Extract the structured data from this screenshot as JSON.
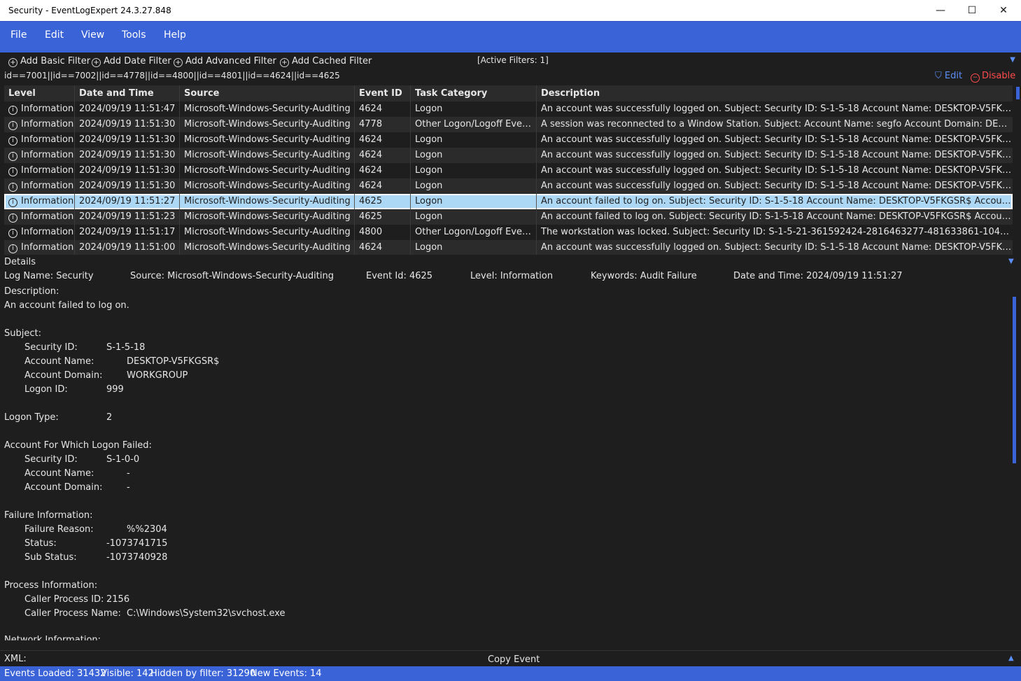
{
  "window": {
    "title": "Security - EventLogExpert 24.3.27.848",
    "minimize": "—",
    "maximize": "☐",
    "close": "✕"
  },
  "menu": [
    "File",
    "Edit",
    "View",
    "Tools",
    "Help"
  ],
  "filter_bar": {
    "add_basic": "Add Basic Filter",
    "add_date": "Add Date Filter",
    "add_advanced": "Add Advanced Filter",
    "add_cached": "Add Cached Filter",
    "active_filters": "[Active Filters: 1]",
    "expression": "id==7001||id==7002||id==4778||id==4800||id==4801||id==4624||id==4625",
    "edit_label": "Edit",
    "disable_label": "Disable"
  },
  "table": {
    "columns": [
      "Level",
      "Date and Time",
      "Source",
      "Event ID",
      "Task Category",
      "Description"
    ],
    "rows": [
      {
        "level": "Information",
        "date": "2024/09/19 11:51:47",
        "source": "Microsoft-Windows-Security-Auditing",
        "event_id": "4624",
        "task": "Logon",
        "desc": "An account was successfully logged on. Subject: Security ID: S-1-5-18 Account Name: DESKTOP-V5FKGSR$ Acco..."
      },
      {
        "level": "Information",
        "date": "2024/09/19 11:51:30",
        "source": "Microsoft-Windows-Security-Auditing",
        "event_id": "4778",
        "task": "Other Logon/Logoff Events",
        "desc": "A session was reconnected to a Window Station. Subject: Account Name: segfo Account Domain: DESKTOP-V5FK..."
      },
      {
        "level": "Information",
        "date": "2024/09/19 11:51:30",
        "source": "Microsoft-Windows-Security-Auditing",
        "event_id": "4624",
        "task": "Logon",
        "desc": "An account was successfully logged on. Subject: Security ID: S-1-5-18 Account Name: DESKTOP-V5FKGSR$ Acco..."
      },
      {
        "level": "Information",
        "date": "2024/09/19 11:51:30",
        "source": "Microsoft-Windows-Security-Auditing",
        "event_id": "4624",
        "task": "Logon",
        "desc": "An account was successfully logged on. Subject: Security ID: S-1-5-18 Account Name: DESKTOP-V5FKGSR$ Acco..."
      },
      {
        "level": "Information",
        "date": "2024/09/19 11:51:30",
        "source": "Microsoft-Windows-Security-Auditing",
        "event_id": "4624",
        "task": "Logon",
        "desc": "An account was successfully logged on. Subject: Security ID: S-1-5-18 Account Name: DESKTOP-V5FKGSR$ Acco..."
      },
      {
        "level": "Information",
        "date": "2024/09/19 11:51:30",
        "source": "Microsoft-Windows-Security-Auditing",
        "event_id": "4624",
        "task": "Logon",
        "desc": "An account was successfully logged on. Subject: Security ID: S-1-5-18 Account Name: DESKTOP-V5FKGSR$ Acco..."
      },
      {
        "level": "Information",
        "date": "2024/09/19 11:51:27",
        "source": "Microsoft-Windows-Security-Auditing",
        "event_id": "4625",
        "task": "Logon",
        "desc": "An account failed to log on. Subject: Security ID: S-1-5-18 Account Name: DESKTOP-V5FKGSR$ Account Domain:..."
      },
      {
        "level": "Information",
        "date": "2024/09/19 11:51:23",
        "source": "Microsoft-Windows-Security-Auditing",
        "event_id": "4625",
        "task": "Logon",
        "desc": "An account failed to log on. Subject: Security ID: S-1-5-18 Account Name: DESKTOP-V5FKGSR$ Account Domain:..."
      },
      {
        "level": "Information",
        "date": "2024/09/19 11:51:17",
        "source": "Microsoft-Windows-Security-Auditing",
        "event_id": "4800",
        "task": "Other Logon/Logoff Events",
        "desc": "The workstation was locked. Subject: Security ID: S-1-5-21-361592424-2816463277-481633861-1043 Account N..."
      },
      {
        "level": "Information",
        "date": "2024/09/19 11:51:00",
        "source": "Microsoft-Windows-Security-Auditing",
        "event_id": "4624",
        "task": "Logon",
        "desc": "An account was successfully logged on. Subject: Security ID: S-1-5-18 Account Name: DESKTOP-V5FKGSR$ Acco..."
      }
    ],
    "selected_index": 6
  },
  "details": {
    "header": "Details",
    "log_name": "Log Name: Security",
    "source": "Source: Microsoft-Windows-Security-Auditing",
    "event_id": "Event Id: 4625",
    "level": "Level: Information",
    "keywords": "Keywords: Audit Failure",
    "date_time": "Date and Time: 2024/09/19 11:51:27",
    "description_label": "Description:",
    "message": "An account failed to log on.",
    "subject_label": "Subject:",
    "subject_security_id_label": "Security ID:",
    "subject_security_id": "S-1-5-18",
    "subject_account_name_label": "Account Name:",
    "subject_account_name": "DESKTOP-V5FKGSR$",
    "subject_account_domain_label": "Account Domain:",
    "subject_account_domain": "WORKGROUP",
    "subject_logon_id_label": "Logon ID:",
    "subject_logon_id": "999",
    "logon_type_label": "Logon Type:",
    "logon_type": "2",
    "failed_label": "Account For Which Logon Failed:",
    "failed_security_id_label": "Security ID:",
    "failed_security_id": "S-1-0-0",
    "failed_account_name_label": "Account Name:",
    "failed_account_name": "-",
    "failed_account_domain_label": "Account Domain:",
    "failed_account_domain": "-",
    "failure_info_label": "Failure Information:",
    "failure_reason_label": "Failure Reason:",
    "failure_reason": "%%2304",
    "status_label": "Status:",
    "status": "-1073741715",
    "sub_status_label": "Sub Status:",
    "sub_status": "-1073740928",
    "process_info_label": "Process Information:",
    "caller_pid_label": "Caller Process ID:",
    "caller_pid": "2156",
    "caller_name_label": "Caller Process Name:",
    "caller_name": "C:\\Windows\\System32\\svchost.exe",
    "network_info_label": "Network Information:"
  },
  "xml_bar": {
    "label": "XML:",
    "copy_event": "Copy Event"
  },
  "status_bar": {
    "loaded": "Events Loaded: 31432",
    "visible": "Visible: 142",
    "hidden": "Hidden by filter: 31290",
    "new": "New Events: 14"
  },
  "colors": {
    "accent": "#3a63d8",
    "link": "#5b8ff9",
    "disable": "#ff4b4b",
    "selected_row": "#add8f5"
  }
}
